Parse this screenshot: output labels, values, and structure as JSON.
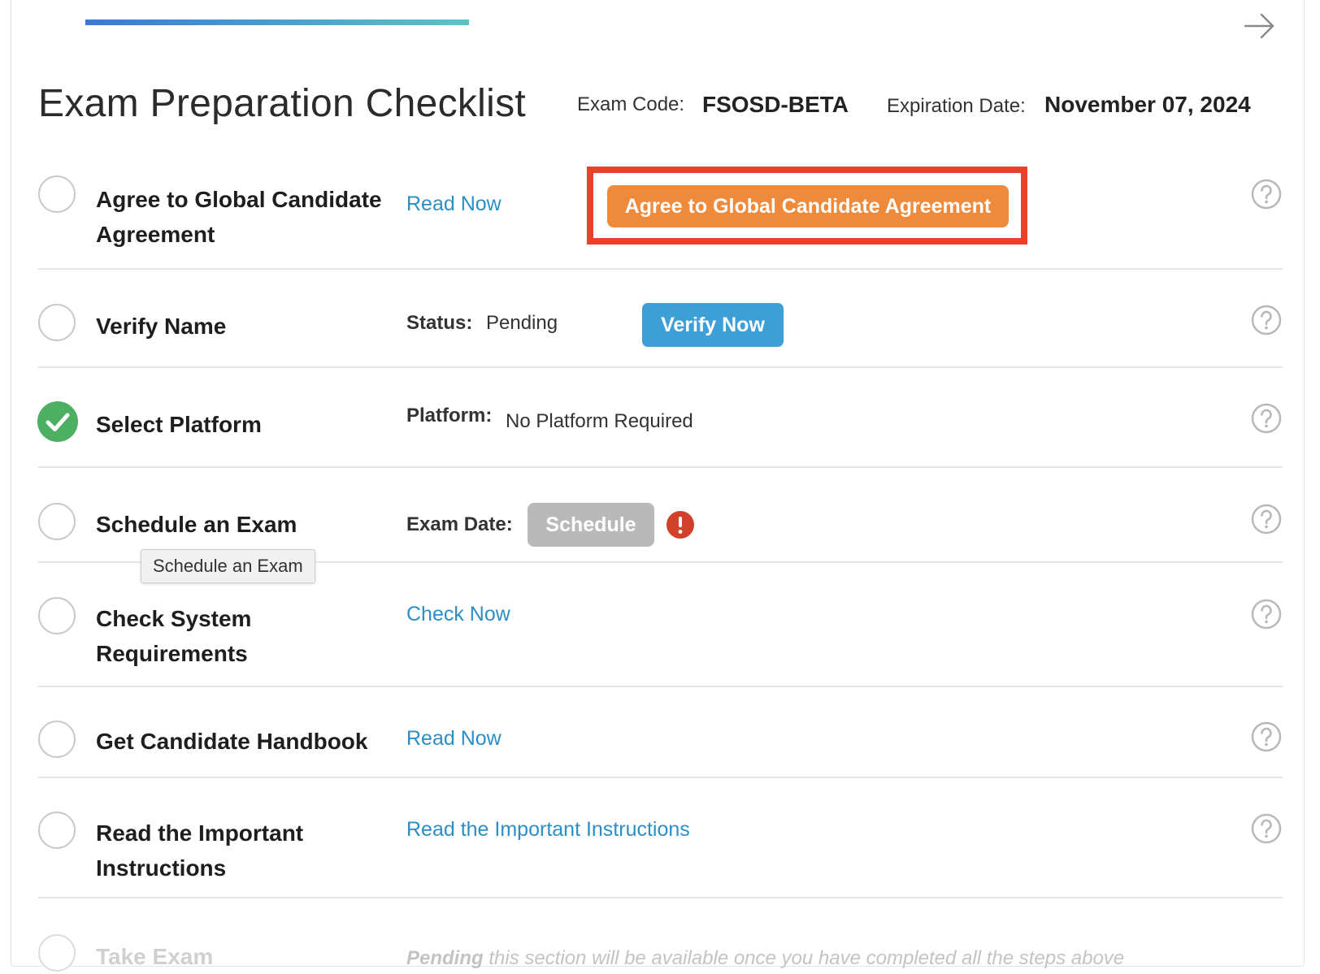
{
  "header": {
    "title": "Exam Preparation Checklist",
    "exam_code_label": "Exam Code:",
    "exam_code": "FSOSD-BETA",
    "expiration_label": "Expiration Date:",
    "expiration_date": "November 07, 2024",
    "progress": 0.3
  },
  "steps": {
    "agree": {
      "title_line1": "Agree to Global Candidate",
      "title_line2": "Agreement",
      "link": "Read Now",
      "button": "Agree to Global Candidate Agreement"
    },
    "verify": {
      "title": "Verify Name",
      "status_label": "Status:",
      "status_value": "Pending",
      "button": "Verify Now"
    },
    "platform": {
      "title": "Select Platform",
      "platform_label": "Platform:",
      "platform_value": "No Platform Required"
    },
    "schedule": {
      "title": "Schedule an Exam",
      "date_label": "Exam Date:",
      "button": "Schedule",
      "tooltip": "Schedule an Exam"
    },
    "system": {
      "title_line1": "Check System",
      "title_line2": "Requirements",
      "link": "Check Now"
    },
    "handbook": {
      "title": "Get Candidate Handbook",
      "link": "Read Now"
    },
    "instructions": {
      "title_line1": "Read the Important",
      "title_line2": "Instructions",
      "link": "Read the Important Instructions"
    },
    "take": {
      "title": "Take Exam",
      "note_bold": "Pending",
      "note_rest": " this section will be available once you have completed all the steps above"
    }
  },
  "colors": {
    "accent_blue": "#3d9fd6",
    "agree_orange": "#ee8a3b",
    "highlight_red": "#e8412c",
    "success_green": "#4caf62",
    "warning_red": "#d0402a",
    "link_blue": "#2b8fc7"
  }
}
